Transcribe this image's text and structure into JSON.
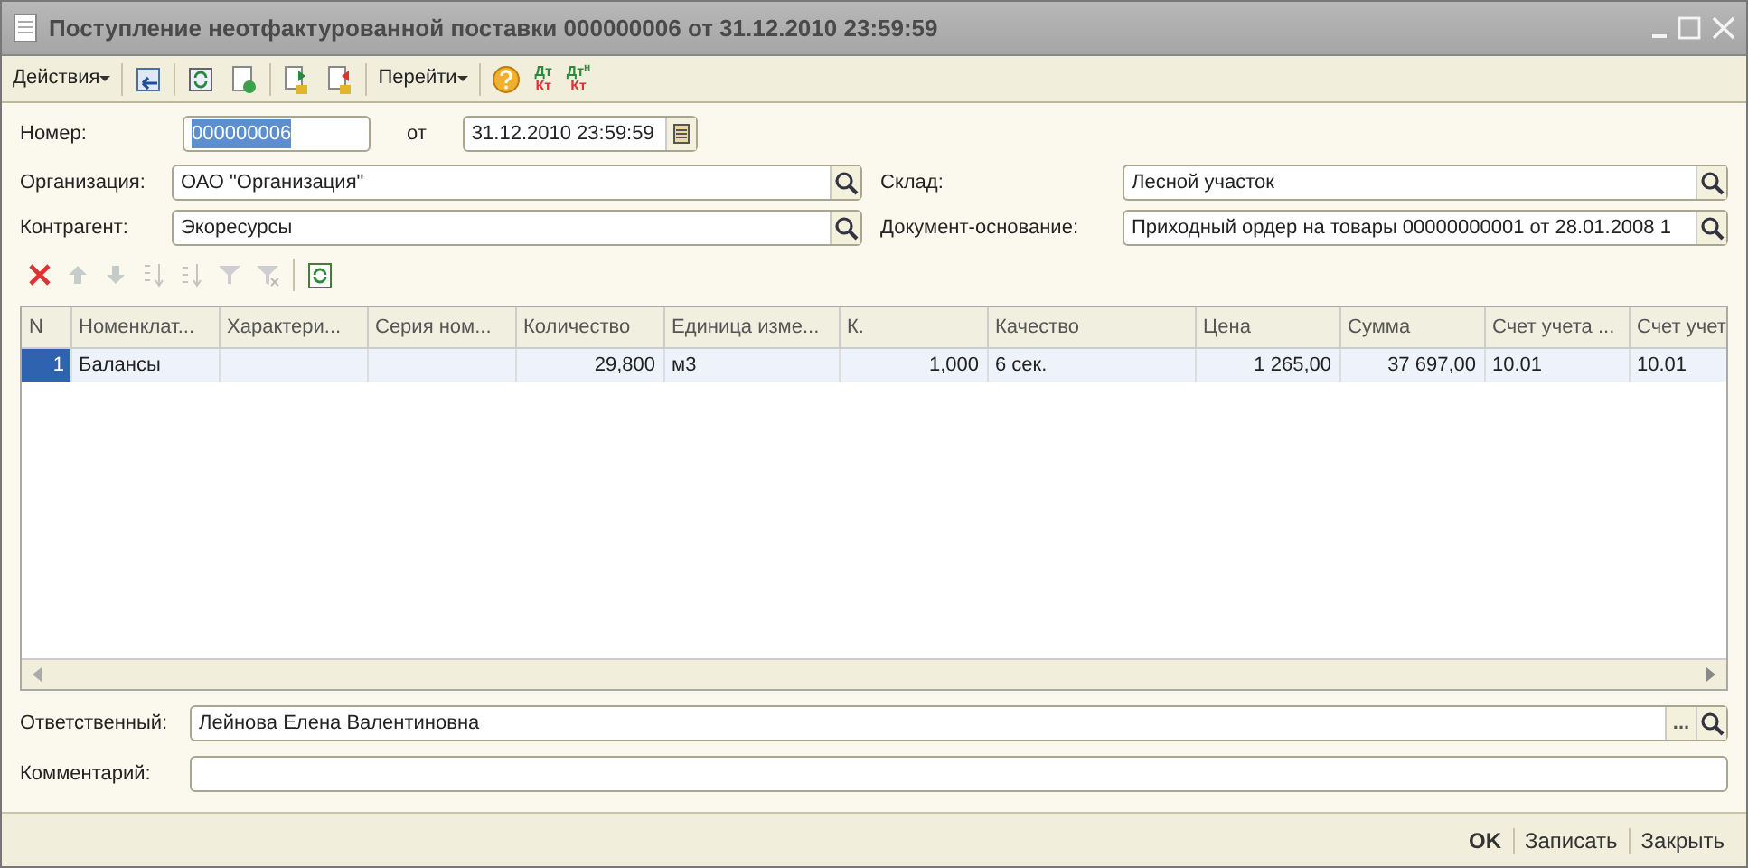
{
  "window": {
    "title": "Поступление неотфактурованной поставки 000000006 от 31.12.2010 23:59:59"
  },
  "toolbar": [
    {
      "kind": "menu",
      "label": "Действия"
    },
    {
      "kind": "sep"
    },
    {
      "kind": "icon"
    },
    {
      "kind": "sep"
    },
    {
      "kind": "icon"
    },
    {
      "kind": "icon"
    },
    {
      "kind": "sep"
    },
    {
      "kind": "icon"
    },
    {
      "kind": "icon"
    },
    {
      "kind": "sep"
    },
    {
      "kind": "menu",
      "label": "Перейти"
    },
    {
      "kind": "sep"
    },
    {
      "kind": "icon"
    },
    {
      "kind": "dtkt",
      "top": "Дт",
      "bottom": "Кт"
    },
    {
      "kind": "dtkt",
      "top": "Дт",
      "sup": "н",
      "bottom": "Кт"
    }
  ],
  "number": {
    "label": "Номер:",
    "value": "000000006",
    "date_label": "от",
    "date": "31.12.2010 23:59:59"
  },
  "fields_left": [
    {
      "label": "Организация:",
      "value": "ОАО \"Организация\""
    },
    {
      "label": "Контрагент:",
      "value": "Экоресурсы"
    }
  ],
  "fields_right": [
    {
      "label": "Склад:",
      "value": "Лесной участок"
    },
    {
      "label": "Документ-основание:",
      "value": "Приходный ордер на товары 00000000001 от 28.01.2008 1"
    }
  ],
  "table_toolbar": [
    {
      "kind": "button",
      "disabled": false
    },
    {
      "kind": "button",
      "disabled": true
    },
    {
      "kind": "button",
      "disabled": true
    },
    {
      "kind": "button",
      "disabled": true
    },
    {
      "kind": "button",
      "disabled": true
    },
    {
      "kind": "button",
      "disabled": true
    },
    {
      "kind": "button",
      "disabled": true
    },
    {
      "kind": "sep"
    },
    {
      "kind": "button",
      "disabled": false
    }
  ],
  "table": {
    "columns": [
      "N",
      "Номенклат...",
      "Характери...",
      "Серия ном...",
      "Количество",
      "Единица изме...",
      "К.",
      "Качество",
      "Цена",
      "Сумма",
      "Счет учета ...",
      "Счет учет"
    ],
    "rows": [
      {
        "selected": true,
        "cells": [
          "1",
          "Балансы",
          "",
          "",
          "29,800",
          "м3",
          "1,000",
          "6 сек.",
          "1 265,00",
          "37 697,00",
          "10.01",
          "10.01"
        ]
      }
    ]
  },
  "responsible": {
    "label": "Ответственный:",
    "value": "Лейнова Елена Валентиновна",
    "more": "..."
  },
  "comment": {
    "label": "Комментарий:"
  },
  "buttons": [
    {
      "label": "OK",
      "default": true
    },
    {
      "label": "Записать",
      "default": false
    },
    {
      "label": "Закрыть",
      "default": false
    }
  ]
}
